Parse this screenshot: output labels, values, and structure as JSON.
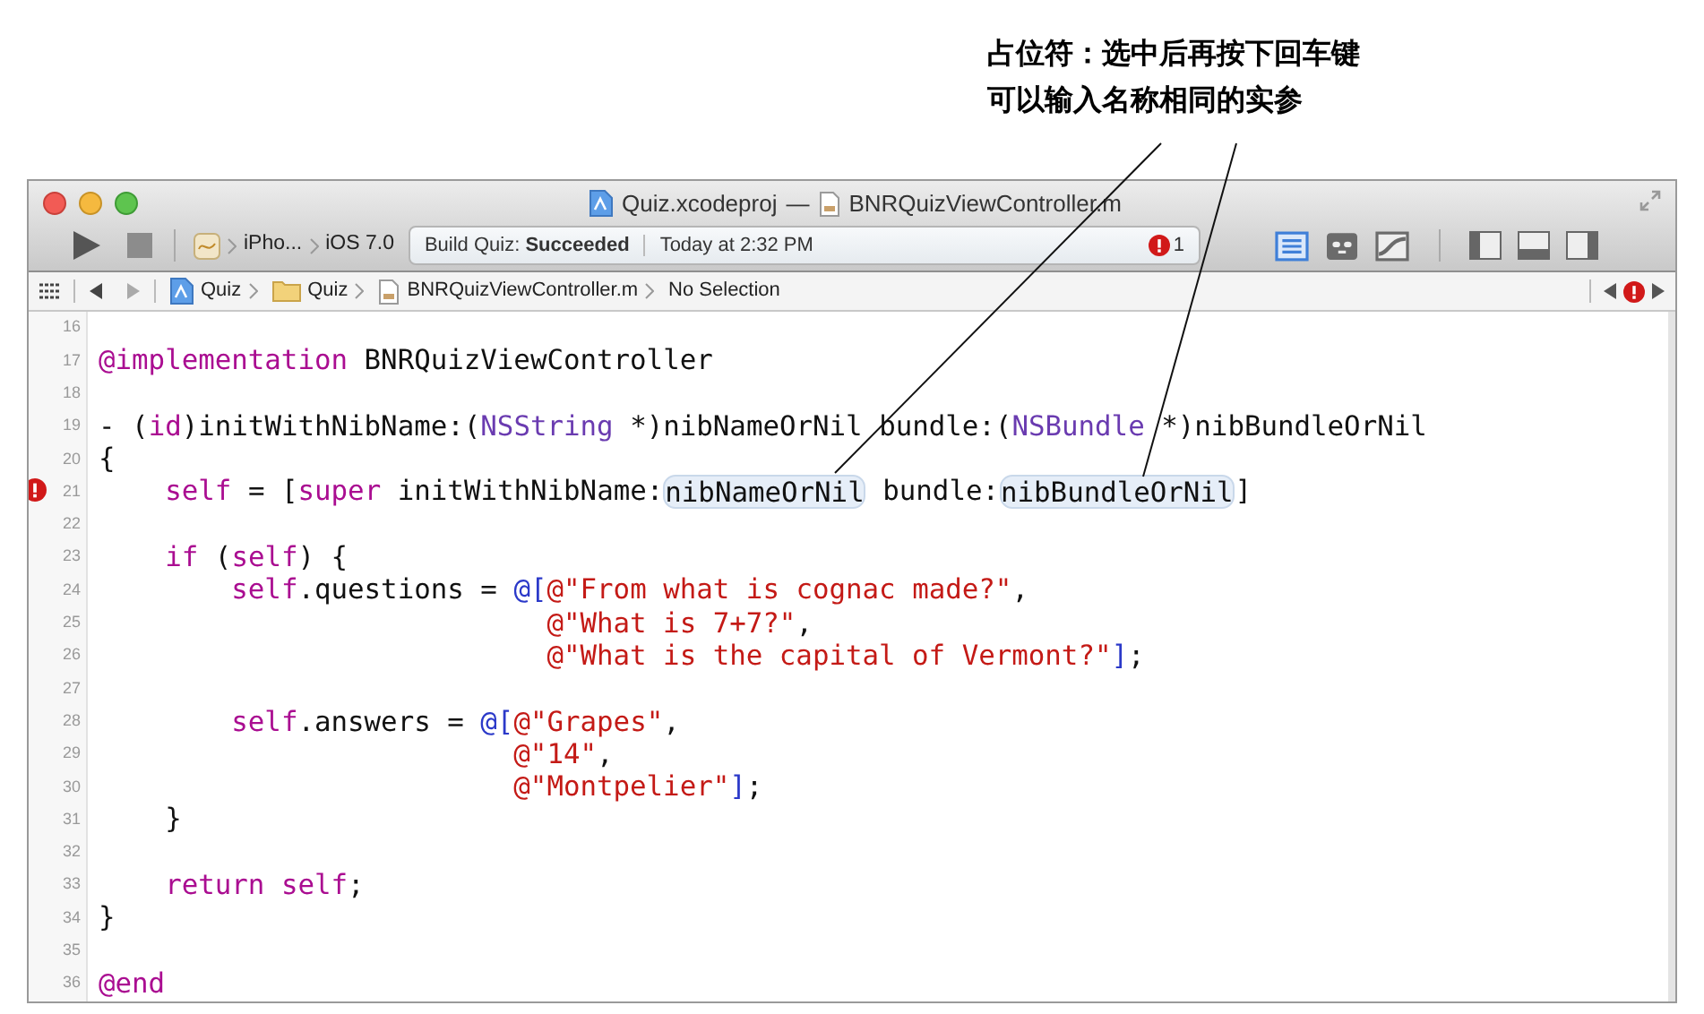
{
  "annotation": {
    "lines": [
      "占位符：选中后再按下回车键",
      "可以输入名称相同的实参"
    ]
  },
  "window": {
    "title_project": "Quiz.xcodeproj",
    "title_separator": "—",
    "title_file": "BNRQuizViewController.m"
  },
  "toolbar": {
    "scheme_target": "iPho...",
    "scheme_sdk": "iOS 7.0",
    "status": "Build Quiz: **Succeeded**",
    "time": "Today at 2:32 PM",
    "error_count": "1",
    "editor_modes": [
      {
        "kind": "standard",
        "selected": true
      },
      {
        "kind": "assistant",
        "selected": false
      },
      {
        "kind": "version",
        "selected": false
      }
    ]
  },
  "jump_bar": {
    "crumbs": [
      {
        "kind": "project",
        "label": "Quiz"
      },
      {
        "kind": "folder",
        "label": "Quiz"
      },
      {
        "kind": "file",
        "label": "BNRQuizViewController.m"
      },
      {
        "kind": "plain",
        "label": "No Selection"
      }
    ]
  },
  "editor": {
    "lines": [
      {
        "number": "16",
        "error": false
      },
      {
        "number": "17",
        "error": false,
        "tokens": [
          {
            "kind": "keyword",
            "text": "@implementation"
          },
          {
            "kind": "plain",
            "text": " BNRQuizViewController"
          }
        ]
      },
      {
        "number": "18",
        "error": false
      },
      {
        "number": "19",
        "error": false,
        "tokens": [
          {
            "kind": "plain",
            "text": "- ("
          },
          {
            "kind": "keyword",
            "text": "id"
          },
          {
            "kind": "plain",
            "text": ")initWithNibName:("
          },
          {
            "kind": "type",
            "text": "NSString"
          },
          {
            "kind": "plain",
            "text": " *)nibNameOrNil bundle:("
          },
          {
            "kind": "type",
            "text": "NSBundle"
          },
          {
            "kind": "plain",
            "text": " *)nibBundleOrNil"
          }
        ]
      },
      {
        "number": "20",
        "error": false,
        "tokens": [
          {
            "kind": "plain",
            "text": "{"
          }
        ]
      },
      {
        "number": "21",
        "error": true,
        "tokens": [
          {
            "kind": "keyword",
            "text": "    self"
          },
          {
            "kind": "plain",
            "text": " = ["
          },
          {
            "kind": "keyword",
            "text": "super"
          },
          {
            "kind": "plain",
            "text": " initWithNibName:"
          },
          {
            "kind": "placeholder",
            "text": "nibNameOrNil"
          },
          {
            "kind": "plain",
            "text": " bundle:"
          },
          {
            "kind": "placeholder",
            "text": "nibBundleOrNil"
          },
          {
            "kind": "plain",
            "text": "]"
          }
        ]
      },
      {
        "number": "22",
        "error": false
      },
      {
        "number": "23",
        "error": false,
        "tokens": [
          {
            "kind": "keyword",
            "text": "    if"
          },
          {
            "kind": "plain",
            "text": " ("
          },
          {
            "kind": "keyword",
            "text": "self"
          },
          {
            "kind": "plain",
            "text": ") {"
          }
        ]
      },
      {
        "number": "24",
        "error": false,
        "tokens": [
          {
            "kind": "keyword",
            "text": "        self"
          },
          {
            "kind": "plain",
            "text": ".questions = "
          },
          {
            "kind": "literal",
            "text": "@["
          },
          {
            "kind": "string",
            "text": "@\"From what is cognac made?\""
          },
          {
            "kind": "plain",
            "text": ","
          }
        ]
      },
      {
        "number": "25",
        "error": false,
        "tokens": [
          {
            "kind": "string",
            "text": "                           @\"What is 7+7?\""
          },
          {
            "kind": "plain",
            "text": ","
          }
        ]
      },
      {
        "number": "26",
        "error": false,
        "tokens": [
          {
            "kind": "string",
            "text": "                           @\"What is the capital of Vermont?\""
          },
          {
            "kind": "literal",
            "text": "]"
          },
          {
            "kind": "plain",
            "text": ";"
          }
        ]
      },
      {
        "number": "27",
        "error": false
      },
      {
        "number": "28",
        "error": false,
        "tokens": [
          {
            "kind": "keyword",
            "text": "        self"
          },
          {
            "kind": "plain",
            "text": ".answers = "
          },
          {
            "kind": "literal",
            "text": "@["
          },
          {
            "kind": "string",
            "text": "@\"Grapes\""
          },
          {
            "kind": "plain",
            "text": ","
          }
        ]
      },
      {
        "number": "29",
        "error": false,
        "tokens": [
          {
            "kind": "string",
            "text": "                         @\"14\""
          },
          {
            "kind": "plain",
            "text": ","
          }
        ]
      },
      {
        "number": "30",
        "error": false,
        "tokens": [
          {
            "kind": "string",
            "text": "                         @\"Montpelier\""
          },
          {
            "kind": "literal",
            "text": "]"
          },
          {
            "kind": "plain",
            "text": ";"
          }
        ]
      },
      {
        "number": "31",
        "error": false,
        "tokens": [
          {
            "kind": "plain",
            "text": "    }"
          }
        ]
      },
      {
        "number": "32",
        "error": false
      },
      {
        "number": "33",
        "error": false,
        "tokens": [
          {
            "kind": "keyword",
            "text": "    return"
          },
          {
            "kind": "keyword",
            "text": " self"
          },
          {
            "kind": "plain",
            "text": ";"
          }
        ]
      },
      {
        "number": "34",
        "error": false,
        "tokens": [
          {
            "kind": "plain",
            "text": "}"
          }
        ]
      },
      {
        "number": "35",
        "error": false
      },
      {
        "number": "36",
        "error": false,
        "tokens": [
          {
            "kind": "keyword",
            "text": "@end"
          }
        ]
      }
    ]
  }
}
